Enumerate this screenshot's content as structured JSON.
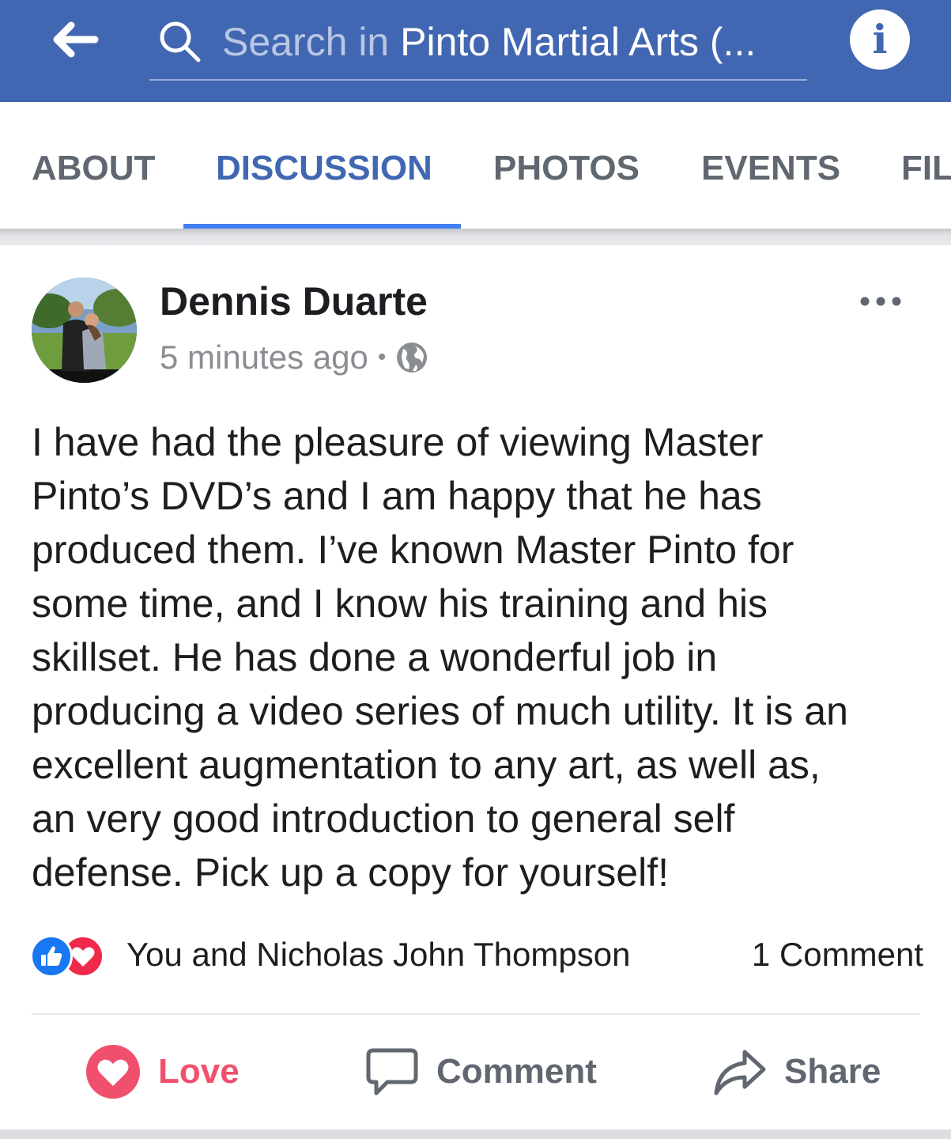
{
  "header": {
    "search_prefix": "Search in ",
    "search_group": "Pinto Martial Arts (...",
    "info_label": "i",
    "background_color": "#4267b2"
  },
  "tabs": [
    {
      "label": "ABOUT",
      "active": false
    },
    {
      "label": "DISCUSSION",
      "active": true
    },
    {
      "label": "PHOTOS",
      "active": false
    },
    {
      "label": "EVENTS",
      "active": false
    },
    {
      "label": "FIL",
      "active": false
    }
  ],
  "post": {
    "author": "Dennis Duarte",
    "timestamp": "5 minutes ago",
    "separator": "•",
    "privacy_icon": "globe-icon",
    "body": "I have had the pleasure of viewing Master\nPinto’s DVD’s and I am happy that he has\nproduced them. I’ve known Master Pinto for\nsome time, and I know his training and his\nskillset.  He has done a wonderful job in\nproducing a video series of much utility. It is an\nexcellent augmentation to any art, as well as,\nan very good introduction to general self\ndefense.  Pick up a copy for yourself!",
    "reactions": {
      "icons": [
        "like-icon",
        "love-icon"
      ],
      "reactors_text": "You and Nicholas John Thompson",
      "comments_text": "1 Comment"
    },
    "actions": [
      {
        "label": "Love",
        "icon": "heart-icon",
        "color": "#f0506e"
      },
      {
        "label": "Comment",
        "icon": "comment-bubble-icon",
        "color": "#606770"
      },
      {
        "label": "Share",
        "icon": "share-arrow-icon",
        "color": "#606770"
      }
    ]
  },
  "colors": {
    "brand_blue": "#4267b2",
    "active_tab": "#4267b2",
    "tab_underline": "#4080ee",
    "love_red": "#f0506e",
    "text_primary": "#1c1e21",
    "text_secondary": "#8a8d91"
  }
}
